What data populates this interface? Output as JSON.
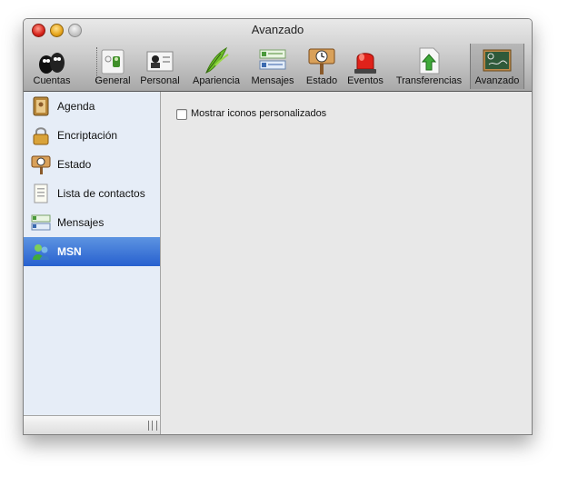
{
  "window": {
    "title": "Avanzado"
  },
  "toolbar": {
    "items": [
      {
        "label": "Cuentas",
        "icon": "accounts-icon"
      },
      {
        "label": "General",
        "icon": "general-icon"
      },
      {
        "label": "Personal",
        "icon": "personal-icon"
      },
      {
        "label": "Apariencia",
        "icon": "appearance-quill-icon"
      },
      {
        "label": "Mensajes",
        "icon": "messages-icon"
      },
      {
        "label": "Estado",
        "icon": "status-sign-icon"
      },
      {
        "label": "Eventos",
        "icon": "events-siren-icon"
      },
      {
        "label": "Transferencias",
        "icon": "transfers-icon"
      },
      {
        "label": "Avanzado",
        "icon": "advanced-chalkboard-icon",
        "selected": true
      }
    ]
  },
  "sidebar": {
    "items": [
      {
        "label": "Agenda",
        "icon": "address-book-icon"
      },
      {
        "label": "Encriptación",
        "icon": "padlock-icon"
      },
      {
        "label": "Estado",
        "icon": "status-sign-icon"
      },
      {
        "label": "Lista de contactos",
        "icon": "contact-list-icon"
      },
      {
        "label": "Mensajes",
        "icon": "messages-icon"
      },
      {
        "label": "MSN",
        "icon": "msn-buddies-icon",
        "selected": true
      }
    ]
  },
  "content": {
    "options": [
      {
        "label": "Mostrar iconos personalizados",
        "checked": false
      }
    ]
  },
  "colors": {
    "selection": "#2f6bd6",
    "sidebar_bg": "#e6edf7",
    "pane_bg": "#e8e8e8"
  }
}
